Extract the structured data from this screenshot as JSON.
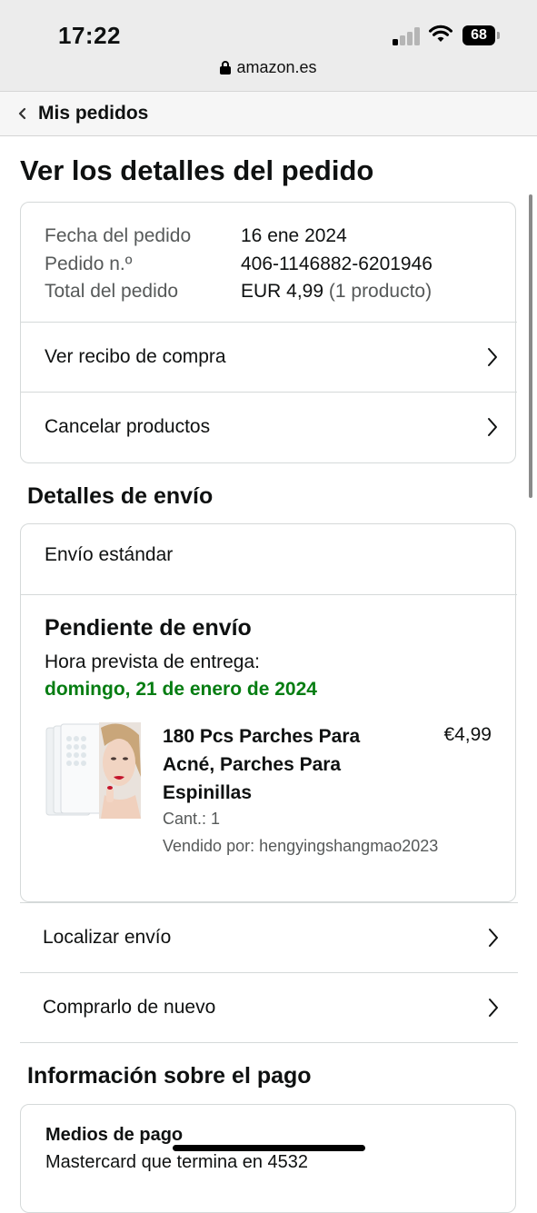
{
  "status_bar": {
    "time": "17:22",
    "battery": "68",
    "url": "amazon.es"
  },
  "nav": {
    "back_label": "Mis pedidos"
  },
  "page_title": "Ver los detalles del pedido",
  "order_summary": {
    "rows": [
      {
        "label": "Fecha del pedido",
        "value": "16 ene 2024",
        "extra": ""
      },
      {
        "label": "Pedido n.º",
        "value": "406-1146882-6201946",
        "extra": ""
      },
      {
        "label": "Total del pedido",
        "value": "EUR 4,99",
        "extra": " (1 producto)"
      }
    ],
    "links": [
      "Ver recibo de compra",
      "Cancelar productos"
    ]
  },
  "shipping": {
    "section_title": "Detalles de envío",
    "method": "Envío estándar",
    "status": "Pendiente de envío",
    "eta_label": "Hora prevista de entrega:",
    "eta_date": "domingo, 21 de enero de 2024",
    "product": {
      "name": "180 Pcs Parches Para Acné, Parches Para Espinillas",
      "price": "€4,99",
      "quantity": "Cant.: 1",
      "seller": "Vendido por: hengyingshangmao2023"
    }
  },
  "actions": [
    "Localizar envío",
    "Comprarlo de nuevo"
  ],
  "payment": {
    "section_title": "Información sobre el pago",
    "methods_title": "Medios de pago",
    "card_text": "Mastercard que termina en 4532"
  },
  "colors": {
    "eta_green": "#067d12",
    "status_bar_bg": "#ececec"
  }
}
